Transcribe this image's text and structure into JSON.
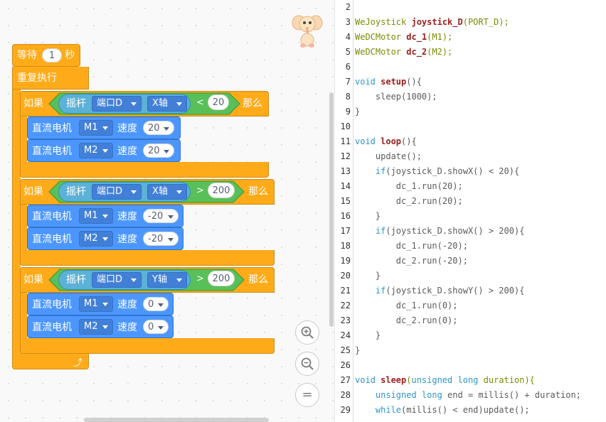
{
  "blocks": {
    "wait": {
      "label": "等待",
      "value": "1",
      "unit": "秒"
    },
    "forever": {
      "label": "重复执行"
    },
    "if_blocks": [
      {
        "if_label": "如果",
        "then_label": "那么",
        "joystick_label": "摇杆",
        "port": "端口D",
        "axis": "X轴",
        "operator": "<",
        "threshold": "20",
        "motors": [
          {
            "label": "直流电机",
            "motor": "M1",
            "speed_label": "速度",
            "speed": "20"
          },
          {
            "label": "直流电机",
            "motor": "M2",
            "speed_label": "速度",
            "speed": "20"
          }
        ]
      },
      {
        "if_label": "如果",
        "then_label": "那么",
        "joystick_label": "摇杆",
        "port": "端口D",
        "axis": "X轴",
        "operator": ">",
        "threshold": "200",
        "motors": [
          {
            "label": "直流电机",
            "motor": "M1",
            "speed_label": "速度",
            "speed": "-20"
          },
          {
            "label": "直流电机",
            "motor": "M2",
            "speed_label": "速度",
            "speed": "-20"
          }
        ]
      },
      {
        "if_label": "如果",
        "then_label": "那么",
        "joystick_label": "摇杆",
        "port": "端口D",
        "axis": "Y轴",
        "operator": ">",
        "threshold": "200",
        "motors": [
          {
            "label": "直流电机",
            "motor": "M1",
            "speed_label": "速度",
            "speed": "0"
          },
          {
            "label": "直流电机",
            "motor": "M2",
            "speed_label": "速度",
            "speed": "0"
          }
        ]
      }
    ]
  },
  "zoom": {
    "in": "+",
    "out": "−",
    "reset": "="
  },
  "icons": {
    "mascot": "elephant-mascot-icon",
    "zoom_in": "zoom-in-icon",
    "zoom_out": "zoom-out-icon",
    "reset": "zoom-reset-icon",
    "loop_arrow": "loop-arrow-icon"
  },
  "colors": {
    "control": "#ffab19",
    "motion": "#4c97ff",
    "operator": "#59c059",
    "sensing": "#5cb1d6"
  },
  "code": {
    "lines": [
      {
        "n": "2",
        "tokens": []
      },
      {
        "n": "3",
        "tokens": [
          [
            "type",
            "WeJoystick "
          ],
          [
            "fn",
            "joystick_D"
          ],
          [
            "type",
            "(PORT_D);"
          ]
        ]
      },
      {
        "n": "4",
        "tokens": [
          [
            "type",
            "WeDCMotor "
          ],
          [
            "fn",
            "dc_1"
          ],
          [
            "type",
            "(M1);"
          ]
        ]
      },
      {
        "n": "5",
        "tokens": [
          [
            "type",
            "WeDCMotor "
          ],
          [
            "fn",
            "dc_2"
          ],
          [
            "type",
            "(M2);"
          ]
        ]
      },
      {
        "n": "6",
        "tokens": []
      },
      {
        "n": "7",
        "tokens": [
          [
            "kw",
            "void "
          ],
          [
            "fn",
            "setup"
          ],
          [
            "plain",
            "(){"
          ]
        ]
      },
      {
        "n": "8",
        "tokens": [
          [
            "plain",
            "    sleep(1000);"
          ]
        ]
      },
      {
        "n": "9",
        "tokens": [
          [
            "plain",
            "}"
          ]
        ]
      },
      {
        "n": "10",
        "tokens": []
      },
      {
        "n": "11",
        "tokens": [
          [
            "kw",
            "void "
          ],
          [
            "fn",
            "loop"
          ],
          [
            "plain",
            "(){"
          ]
        ]
      },
      {
        "n": "12",
        "tokens": [
          [
            "plain",
            "    update();"
          ]
        ]
      },
      {
        "n": "13",
        "tokens": [
          [
            "kw",
            "    if"
          ],
          [
            "plain",
            "(joystick_D.showX() < 20){"
          ]
        ]
      },
      {
        "n": "14",
        "tokens": [
          [
            "plain",
            "        dc_1.run(20);"
          ]
        ]
      },
      {
        "n": "15",
        "tokens": [
          [
            "plain",
            "        dc_2.run(20);"
          ]
        ]
      },
      {
        "n": "16",
        "tokens": [
          [
            "plain",
            "    }"
          ]
        ]
      },
      {
        "n": "17",
        "tokens": [
          [
            "kw",
            "    if"
          ],
          [
            "plain",
            "(joystick_D.showX() > 200){"
          ]
        ]
      },
      {
        "n": "18",
        "tokens": [
          [
            "plain",
            "        dc_1.run(-20);"
          ]
        ]
      },
      {
        "n": "19",
        "tokens": [
          [
            "plain",
            "        dc_2.run(-20);"
          ]
        ]
      },
      {
        "n": "20",
        "tokens": [
          [
            "plain",
            "    }"
          ]
        ]
      },
      {
        "n": "21",
        "tokens": [
          [
            "kw",
            "    if"
          ],
          [
            "plain",
            "(joystick_D.showY() > 200){"
          ]
        ]
      },
      {
        "n": "22",
        "tokens": [
          [
            "plain",
            "        dc_1.run(0);"
          ]
        ]
      },
      {
        "n": "23",
        "tokens": [
          [
            "plain",
            "        dc_2.run(0);"
          ]
        ]
      },
      {
        "n": "24",
        "tokens": [
          [
            "plain",
            "    }"
          ]
        ]
      },
      {
        "n": "25",
        "tokens": [
          [
            "plain",
            "}"
          ]
        ]
      },
      {
        "n": "26",
        "tokens": []
      },
      {
        "n": "27",
        "tokens": [
          [
            "kw",
            "void "
          ],
          [
            "fn",
            "sleep"
          ],
          [
            "type",
            "("
          ],
          [
            "kw",
            "unsigned long "
          ],
          [
            "type",
            "duration"
          ],
          [
            "type",
            "){"
          ]
        ]
      },
      {
        "n": "28",
        "tokens": [
          [
            "kw",
            "    unsigned long "
          ],
          [
            "plain",
            "end = millis() + duration;"
          ]
        ]
      },
      {
        "n": "29",
        "tokens": [
          [
            "kw",
            "    while"
          ],
          [
            "plain",
            "(millis() < end)update();"
          ]
        ]
      }
    ]
  }
}
